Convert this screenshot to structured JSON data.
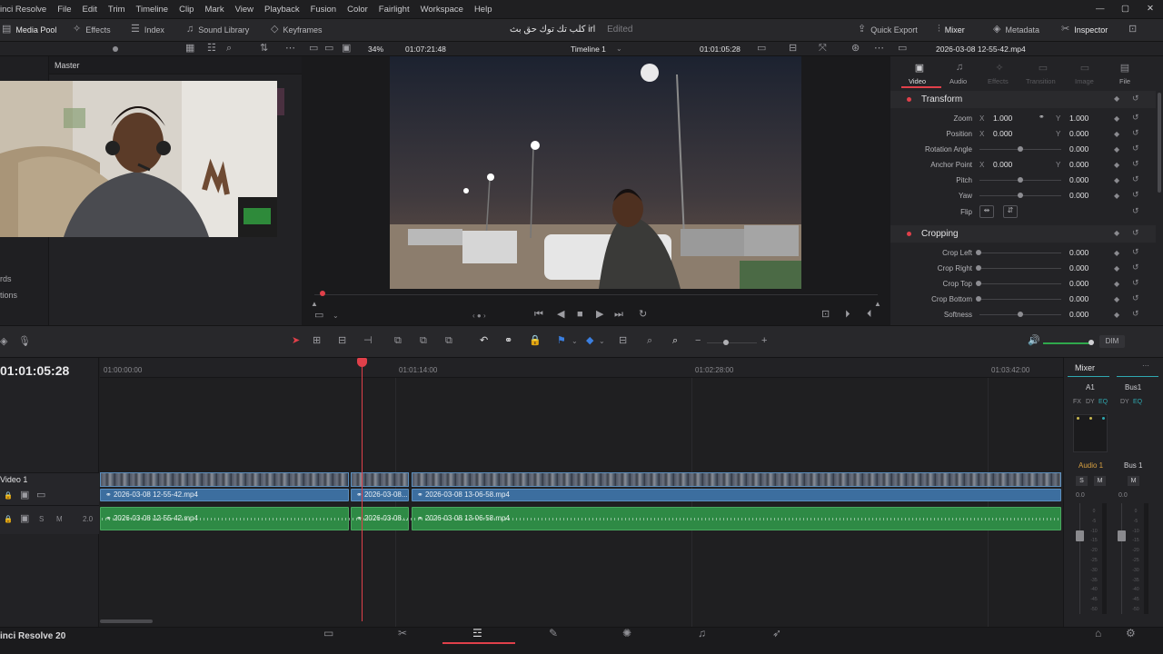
{
  "menu": {
    "items": [
      "inci Resolve",
      "File",
      "Edit",
      "Trim",
      "Timeline",
      "Clip",
      "Mark",
      "View",
      "Playback",
      "Fusion",
      "Color",
      "Fairlight",
      "Workspace",
      "Help"
    ]
  },
  "toolbar": {
    "media_pool": "Media Pool",
    "effects": "Effects",
    "index": "Index",
    "sound_library": "Sound Library",
    "keyframes": "Keyframes",
    "project_title": "كلب تك توك حق بث irl",
    "edited": "Edited",
    "quick_export": "Quick Export",
    "mixer": "Mixer",
    "metadata": "Metadata",
    "inspector": "Inspector"
  },
  "viewer_bar": {
    "zoom": "34%",
    "source_tc": "01:07:21:48",
    "timeline_name": "Timeline 1",
    "record_tc": "01:01:05:28",
    "clip_name": "2026-03-08 12-55-42.mp4"
  },
  "media_pool": {
    "bin": "Master",
    "partial_items": [
      "rds",
      "tions"
    ]
  },
  "inspector": {
    "tabs": [
      "Video",
      "Audio",
      "Effects",
      "Transition",
      "Image",
      "File"
    ],
    "transform_title": "Transform",
    "transform": {
      "zoom_label": "Zoom",
      "zoom_x": "1.000",
      "zoom_y": "1.000",
      "position_label": "Position",
      "position_x": "0.000",
      "position_y": "0.000",
      "rotation_label": "Rotation Angle",
      "rotation": "0.000",
      "anchor_label": "Anchor Point",
      "anchor_x": "0.000",
      "anchor_y": "0.000",
      "pitch_label": "Pitch",
      "pitch": "0.000",
      "yaw_label": "Yaw",
      "yaw": "0.000",
      "flip_label": "Flip"
    },
    "cropping_title": "Cropping",
    "cropping": {
      "left_label": "Crop Left",
      "left": "0.000",
      "right_label": "Crop Right",
      "right": "0.000",
      "top_label": "Crop Top",
      "top": "0.000",
      "bottom_label": "Crop Bottom",
      "bottom": "0.000",
      "softness_label": "Softness",
      "softness": "0.000"
    },
    "x": "X",
    "y": "Y"
  },
  "timeline": {
    "timecode": "01:01:05:28",
    "ruler": [
      "01:00:00:00",
      "01:01:14:00",
      "01:02:28:00",
      "01:03:42:00"
    ],
    "track_name": "Video 1",
    "audio_level": "2.0",
    "clips": [
      "2026-03-08 12-55-42.mp4",
      "2026-03-08...",
      "2026-03-08 13-06-58.mp4"
    ],
    "dim": "DIM"
  },
  "mixer": {
    "title": "Mixer",
    "a1": "A1",
    "bus1": "Bus1",
    "fx": "FX",
    "dy": "DY",
    "eq": "EQ",
    "audio1": "Audio 1",
    "bus1b": "Bus 1",
    "s": "S",
    "m": "M",
    "level_a": "0.0",
    "level_b": "0.0",
    "scale": [
      "0",
      "-5",
      "-10",
      "-15",
      "-20",
      "-25",
      "-30",
      "-35",
      "-40",
      "-45",
      "-50"
    ]
  },
  "footer": {
    "app": "inci Resolve 20"
  },
  "colors": {
    "accent_red": "#e0404a",
    "clip_blue": "#3c6e9f",
    "clip_green": "#2e8a45",
    "playhead": "#e0404a"
  }
}
